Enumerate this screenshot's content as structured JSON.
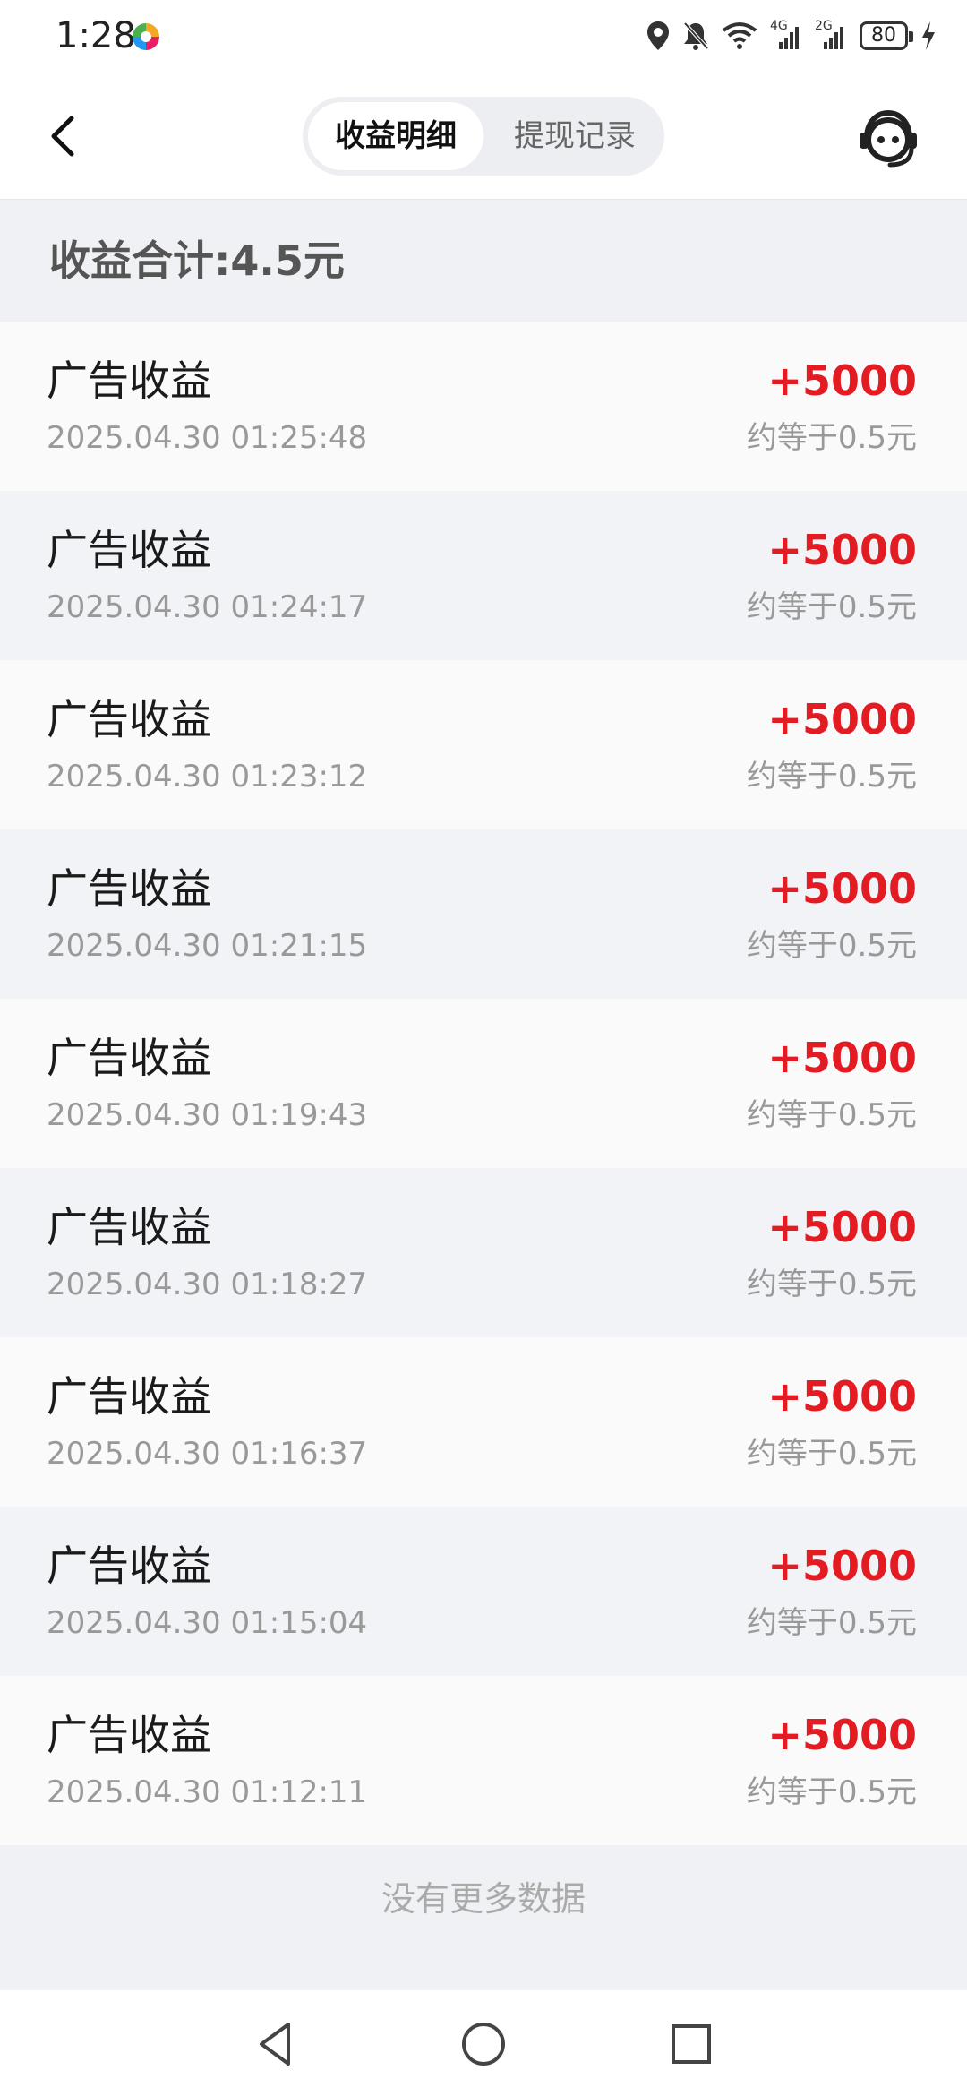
{
  "status_bar": {
    "time": "1:28",
    "battery": "80",
    "net1": "4G",
    "net2": "2G"
  },
  "tabs": [
    {
      "label": "收益明细",
      "active": true
    },
    {
      "label": "提现记录",
      "active": false
    }
  ],
  "summary": {
    "text": "收益合计:4.5元"
  },
  "records": [
    {
      "title": "广告收益",
      "time": "2025.04.30 01:25:48",
      "amount": "+5000",
      "approx": "约等于0.5元"
    },
    {
      "title": "广告收益",
      "time": "2025.04.30 01:24:17",
      "amount": "+5000",
      "approx": "约等于0.5元"
    },
    {
      "title": "广告收益",
      "time": "2025.04.30 01:23:12",
      "amount": "+5000",
      "approx": "约等于0.5元"
    },
    {
      "title": "广告收益",
      "time": "2025.04.30 01:21:15",
      "amount": "+5000",
      "approx": "约等于0.5元"
    },
    {
      "title": "广告收益",
      "time": "2025.04.30 01:19:43",
      "amount": "+5000",
      "approx": "约等于0.5元"
    },
    {
      "title": "广告收益",
      "time": "2025.04.30 01:18:27",
      "amount": "+5000",
      "approx": "约等于0.5元"
    },
    {
      "title": "广告收益",
      "time": "2025.04.30 01:16:37",
      "amount": "+5000",
      "approx": "约等于0.5元"
    },
    {
      "title": "广告收益",
      "time": "2025.04.30 01:15:04",
      "amount": "+5000",
      "approx": "约等于0.5元"
    },
    {
      "title": "广告收益",
      "time": "2025.04.30 01:12:11",
      "amount": "+5000",
      "approx": "约等于0.5元"
    }
  ],
  "footer": {
    "no_more": "没有更多数据"
  },
  "colors": {
    "amount": "#e31b23",
    "background": "#f0f1f4"
  },
  "icons": {
    "back": "chevron-left-icon",
    "service": "customer-service-icon",
    "sys_back": "triangle-back-icon",
    "sys_home": "circle-home-icon",
    "sys_recent": "square-recent-icon"
  }
}
